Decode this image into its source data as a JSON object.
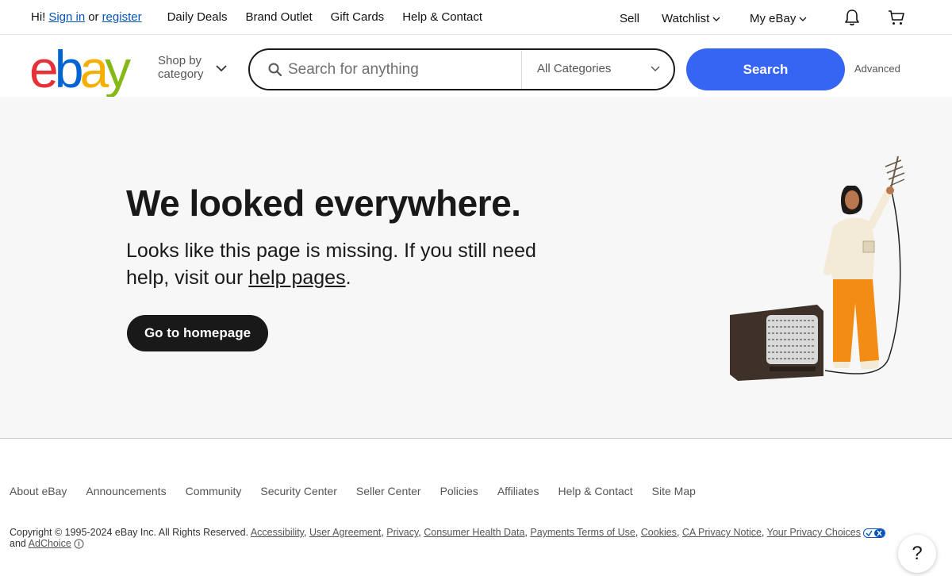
{
  "topbar": {
    "greeting": "Hi!",
    "sign_in": "Sign in",
    "or": "or",
    "register": "register",
    "nav": [
      "Daily Deals",
      "Brand Outlet",
      "Gift Cards",
      "Help & Contact"
    ],
    "sell": "Sell",
    "watchlist": "Watchlist",
    "my_ebay": "My eBay"
  },
  "header": {
    "logo": [
      "e",
      "b",
      "a",
      "y"
    ],
    "logo_colors": [
      "#e53238",
      "#0064d2",
      "#f5af02",
      "#86b817"
    ],
    "shop_by_line1": "Shop by",
    "shop_by_line2": "category",
    "search_placeholder": "Search for anything",
    "category": "All Categories",
    "search_button": "Search",
    "advanced": "Advanced"
  },
  "hero": {
    "title": "We looked everywhere.",
    "message_pre": "Looks like this page is missing. If you still need help, visit our ",
    "help_link": "help pages",
    "message_post": ".",
    "home_button": "Go to homepage"
  },
  "footer": {
    "links": [
      "About eBay",
      "Announcements",
      "Community",
      "Security Center",
      "Seller Center",
      "Policies",
      "Affiliates",
      "Help & Contact",
      "Site Map"
    ],
    "copyright": "Copyright © 1995-2024 eBay Inc. All Rights Reserved.",
    "legal_links": [
      "Accessibility",
      "User Agreement",
      "Privacy",
      "Consumer Health Data",
      "Payments Terms of Use",
      "Cookies",
      "CA Privacy Notice",
      "Your Privacy Choices"
    ],
    "and": "and",
    "adchoice": "AdChoice",
    "help_bubble": "?"
  }
}
